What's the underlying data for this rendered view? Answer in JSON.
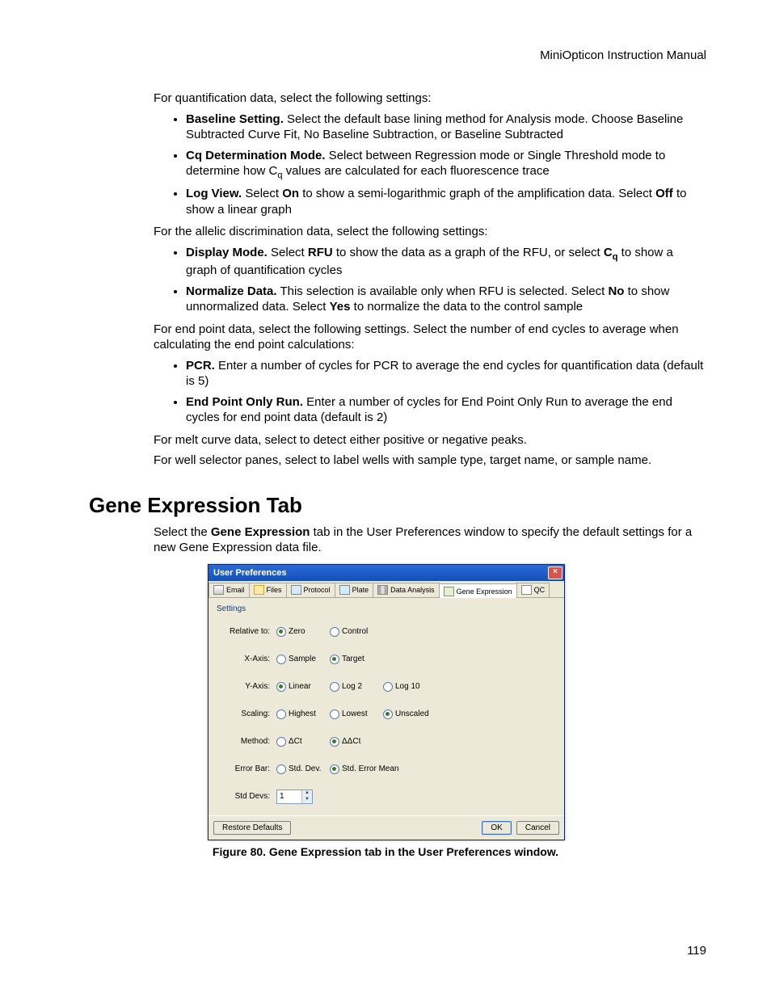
{
  "header": "MiniOpticon Instruction Manual",
  "intro_quant": "For quantification data, select the following settings:",
  "b_baseline_label": "Baseline Setting.",
  "b_baseline_text": " Select the default base lining method for Analysis mode. Choose Baseline Subtracted Curve Fit, No Baseline Subtraction, or Baseline Subtracted",
  "b_cq_label": "Cq Determination Mode.",
  "b_cq_text_a": " Select between Regression mode or Single Threshold mode to determine how C",
  "b_cq_text_b": " values are calculated for each fluorescence trace",
  "b_log_label": "Log View.",
  "b_log_text_a": " Select ",
  "b_log_on": "On",
  "b_log_text_b": " to show a semi-logarithmic graph of the amplification data. Select ",
  "b_log_off": "Off",
  "b_log_text_c": " to show a linear graph",
  "intro_allelic": "For the allelic discrimination data, select the following settings:",
  "b_dm_label": "Display Mode.",
  "b_dm_text_a": " Select ",
  "b_dm_rfu": "RFU",
  "b_dm_text_b": " to show the data as a graph of the RFU, or select ",
  "b_dm_cq": "C",
  "b_dm_text_c": " to show a graph of quantification cycles",
  "b_nd_label": "Normalize Data.",
  "b_nd_text_a": " This selection is available only when RFU is selected. Select ",
  "b_nd_no": "No",
  "b_nd_text_b": " to show unnormalized data. Select ",
  "b_nd_yes": "Yes",
  "b_nd_text_c": " to normalize the data to the control sample",
  "intro_endpoint": "For end point data, select the following settings. Select the number of end cycles to average when calculating the end point calculations:",
  "b_pcr_label": "PCR.",
  "b_pcr_text": " Enter a number of cycles for PCR to average the end cycles for quantification data (default is 5)",
  "b_epor_label": "End Point Only Run.",
  "b_epor_text": " Enter a number of cycles for End Point Only Run to average the end cycles for end point data (default is 2)",
  "intro_melt": "For melt curve data, select to detect either positive or negative peaks.",
  "intro_well": "For well selector panes, select to label wells with sample type, target name, or sample name.",
  "section_title": "Gene Expression Tab",
  "section_text_a": "Select the ",
  "section_text_bold": "Gene Expression",
  "section_text_b": " tab in the User Preferences window to specify the default settings for a new Gene Expression data file.",
  "figure_caption": "Figure 80. Gene Expression tab in the User Preferences window.",
  "page_number": "119",
  "sub_q": "q",
  "win": {
    "title": "User Preferences",
    "close": "×",
    "tabs": {
      "email": "Email",
      "files": "Files",
      "protocol": "Protocol",
      "plate": "Plate",
      "data_analysis": "Data Analysis",
      "gene_expression": "Gene Expression",
      "qc": "QC"
    },
    "section": "Settings",
    "rows": {
      "relative_to": {
        "label": "Relative to:",
        "zero": "Zero",
        "control": "Control"
      },
      "x_axis": {
        "label": "X-Axis:",
        "sample": "Sample",
        "target": "Target"
      },
      "y_axis": {
        "label": "Y-Axis:",
        "linear": "Linear",
        "log2": "Log 2",
        "log10": "Log 10"
      },
      "scaling": {
        "label": "Scaling:",
        "highest": "Highest",
        "lowest": "Lowest",
        "unscaled": "Unscaled"
      },
      "method": {
        "label": "Method:",
        "dct": "ΔCt",
        "ddct": "ΔΔCt"
      },
      "error_bar": {
        "label": "Error Bar:",
        "std_dev": "Std. Dev.",
        "sem": "Std. Error Mean"
      },
      "std_devs": {
        "label": "Std Devs:",
        "value": "1"
      }
    },
    "buttons": {
      "restore": "Restore Defaults",
      "ok": "OK",
      "cancel": "Cancel"
    }
  }
}
